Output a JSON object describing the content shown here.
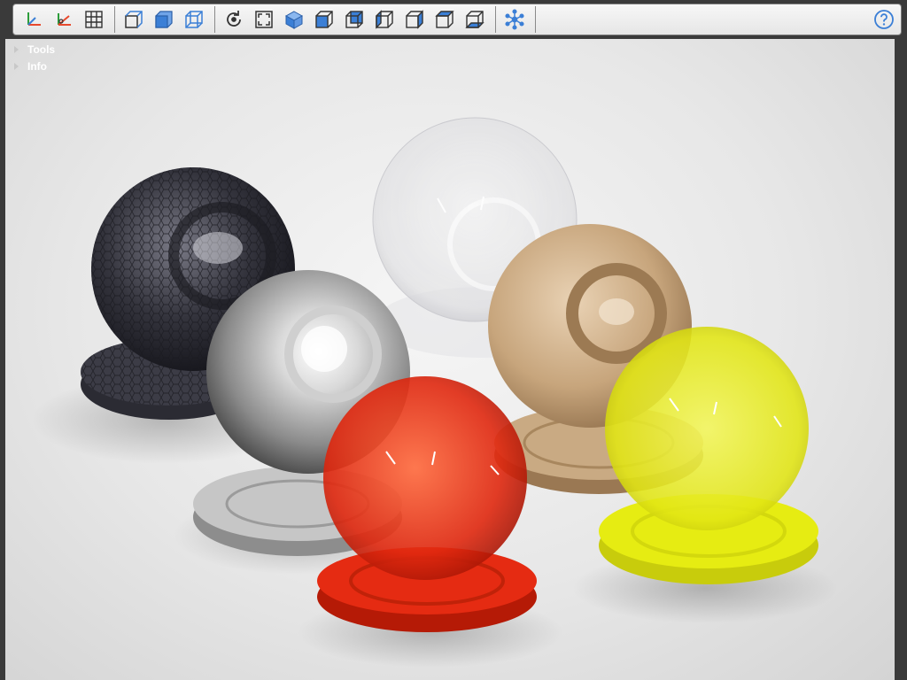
{
  "toolbar": {
    "buttons": [
      {
        "name": "axes-icon",
        "group": "view"
      },
      {
        "name": "axes-reset-icon",
        "group": "view"
      },
      {
        "name": "grid-icon",
        "group": "view"
      },
      {
        "name": "cube-perspective-icon",
        "group": "camera"
      },
      {
        "name": "cube-solid-icon",
        "group": "camera"
      },
      {
        "name": "cube-wireframe-icon",
        "group": "camera"
      },
      {
        "name": "rotate-icon",
        "group": "nav"
      },
      {
        "name": "fit-view-icon",
        "group": "nav"
      },
      {
        "name": "view-iso-icon",
        "group": "nav"
      },
      {
        "name": "view-front-icon",
        "group": "nav"
      },
      {
        "name": "view-back-icon",
        "group": "nav"
      },
      {
        "name": "view-left-icon",
        "group": "nav"
      },
      {
        "name": "view-right-icon",
        "group": "nav"
      },
      {
        "name": "view-top-icon",
        "group": "nav"
      },
      {
        "name": "view-bottom-icon",
        "group": "nav"
      },
      {
        "name": "network-icon",
        "group": "extra"
      }
    ],
    "help_icon": "help-icon",
    "accent_color": "#3b7fd6"
  },
  "panels": [
    {
      "label": "Tools"
    },
    {
      "label": "Info"
    }
  ],
  "scene": {
    "materials": [
      {
        "name": "hex-metal-sphere",
        "color": "#3a3a44"
      },
      {
        "name": "clear-glass-sphere",
        "color": "#e8e8ea"
      },
      {
        "name": "chrome-sphere",
        "color": "#b0b0b0"
      },
      {
        "name": "wood-sphere",
        "color": "#c9aa83"
      },
      {
        "name": "red-glass-sphere",
        "color": "#e52b12"
      },
      {
        "name": "yellow-glass-sphere",
        "color": "#e6ec12"
      }
    ]
  }
}
